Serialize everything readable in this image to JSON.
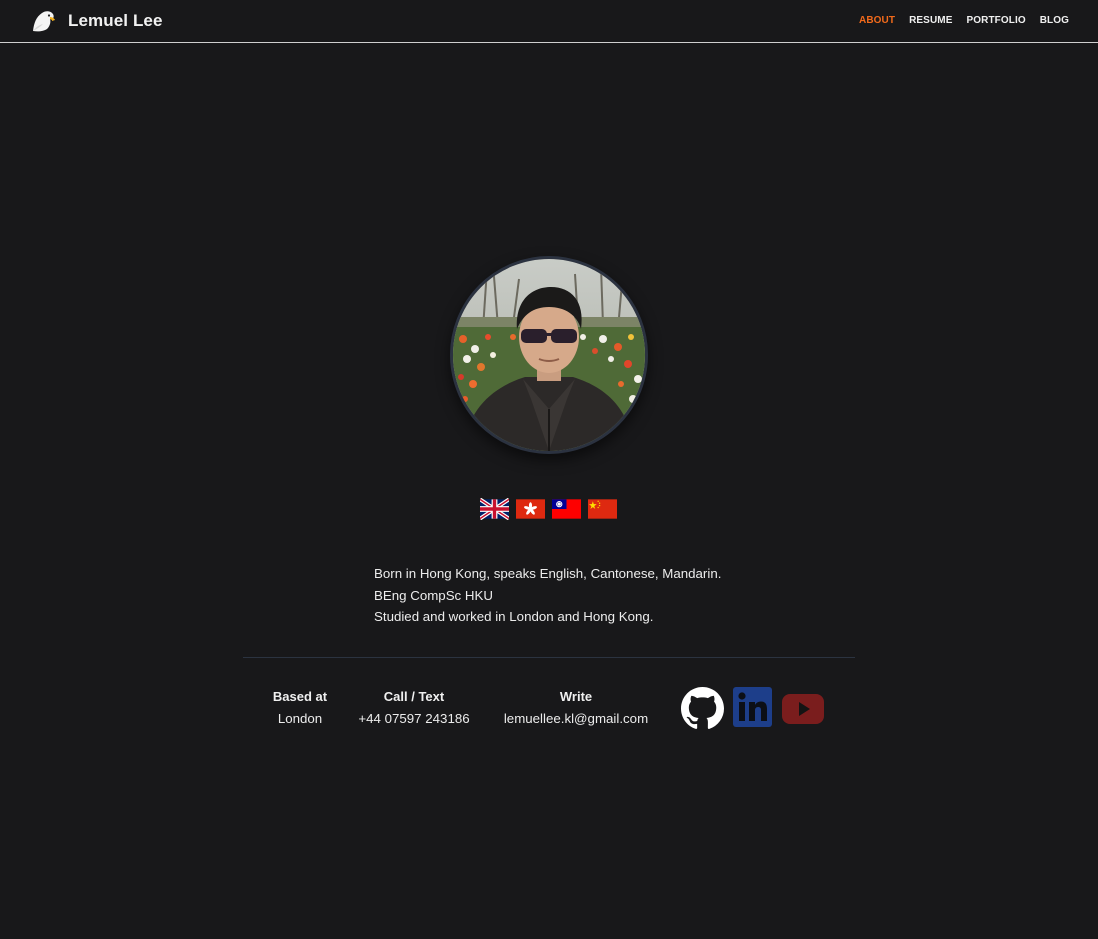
{
  "header": {
    "brand_name": "Lemuel Lee",
    "logo_icon": "eagle-icon",
    "nav": [
      {
        "label": "ABOUT",
        "active": true
      },
      {
        "label": "RESUME",
        "active": false
      },
      {
        "label": "PORTFOLIO",
        "active": false
      },
      {
        "label": "BLOG",
        "active": false
      }
    ],
    "active_color": "#f26a1b"
  },
  "profile": {
    "photo_icon": "profile-photo",
    "flags": [
      "united-kingdom-flag-icon",
      "hong-kong-flag-icon",
      "taiwan-flag-icon",
      "china-flag-icon"
    ],
    "bio": [
      "Born in Hong Kong, speaks English, Cantonese, Mandarin.",
      "BEng CompSc HKU",
      "Studied and worked in London and Hong Kong."
    ]
  },
  "contact": {
    "based": {
      "label": "Based at",
      "value": "London"
    },
    "call": {
      "label": "Call / Text",
      "value": "+44 07597 243186"
    },
    "write": {
      "label": "Write",
      "value": "lemuellee.kl@gmail.com"
    }
  },
  "social": [
    {
      "icon": "github-icon",
      "color": "#ffffff"
    },
    {
      "icon": "linkedin-icon",
      "color": "#1d3e8a"
    },
    {
      "icon": "youtube-icon",
      "color": "#7a1d1d"
    }
  ],
  "colors": {
    "background": "#18181a",
    "accent": "#f26a1b"
  }
}
